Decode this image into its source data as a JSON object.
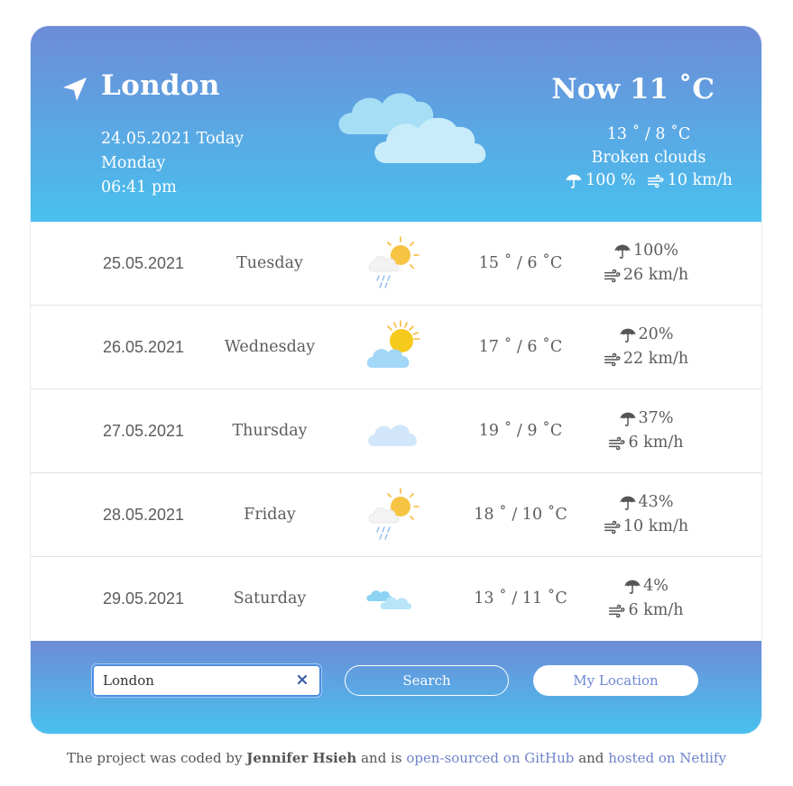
{
  "current": {
    "city": "London",
    "date": "24.05.2021 Today",
    "day": "Monday",
    "time": "06:41 pm",
    "now_label": "Now 11 ˚C",
    "range": "13 ˚ / 8 ˚C",
    "description": "Broken clouds",
    "precip": "100 %",
    "wind": "10 km/h",
    "icon": "broken-clouds-icon"
  },
  "forecast": [
    {
      "date": "25.05.2021",
      "day": "Tuesday",
      "temp": "15 ˚ / 6 ˚C",
      "precip": "100%",
      "wind": "26 km/h",
      "icon": "sun-cloud-rain-icon"
    },
    {
      "date": "26.05.2021",
      "day": "Wednesday",
      "temp": "17 ˚ / 6 ˚C",
      "precip": "20%",
      "wind": "22 km/h",
      "icon": "sun-behind-cloud-icon"
    },
    {
      "date": "27.05.2021",
      "day": "Thursday",
      "temp": "19 ˚ / 9 ˚C",
      "precip": "37%",
      "wind": "6 km/h",
      "icon": "cloud-icon"
    },
    {
      "date": "28.05.2021",
      "day": "Friday",
      "temp": "18 ˚ / 10 ˚C",
      "precip": "43%",
      "wind": "10 km/h",
      "icon": "sun-cloud-rain-icon"
    },
    {
      "date": "29.05.2021",
      "day": "Saturday",
      "temp": "13 ˚ / 11 ˚C",
      "precip": "4%",
      "wind": "6 km/h",
      "icon": "small-clouds-icon"
    }
  ],
  "search": {
    "value": "London",
    "search_button": "Search",
    "location_button": "My Location"
  },
  "credit": {
    "prefix": "The project was coded by",
    "author": "Jennifer Hsieh",
    "middle": "and is",
    "github_link": "open-sourced on GitHub",
    "and": "and",
    "netlify_link": "hosted on Netlify"
  },
  "colors": {
    "gradient_top": "#6d8cd8",
    "gradient_bottom": "#49c0ee",
    "link": "#6d82c9"
  }
}
